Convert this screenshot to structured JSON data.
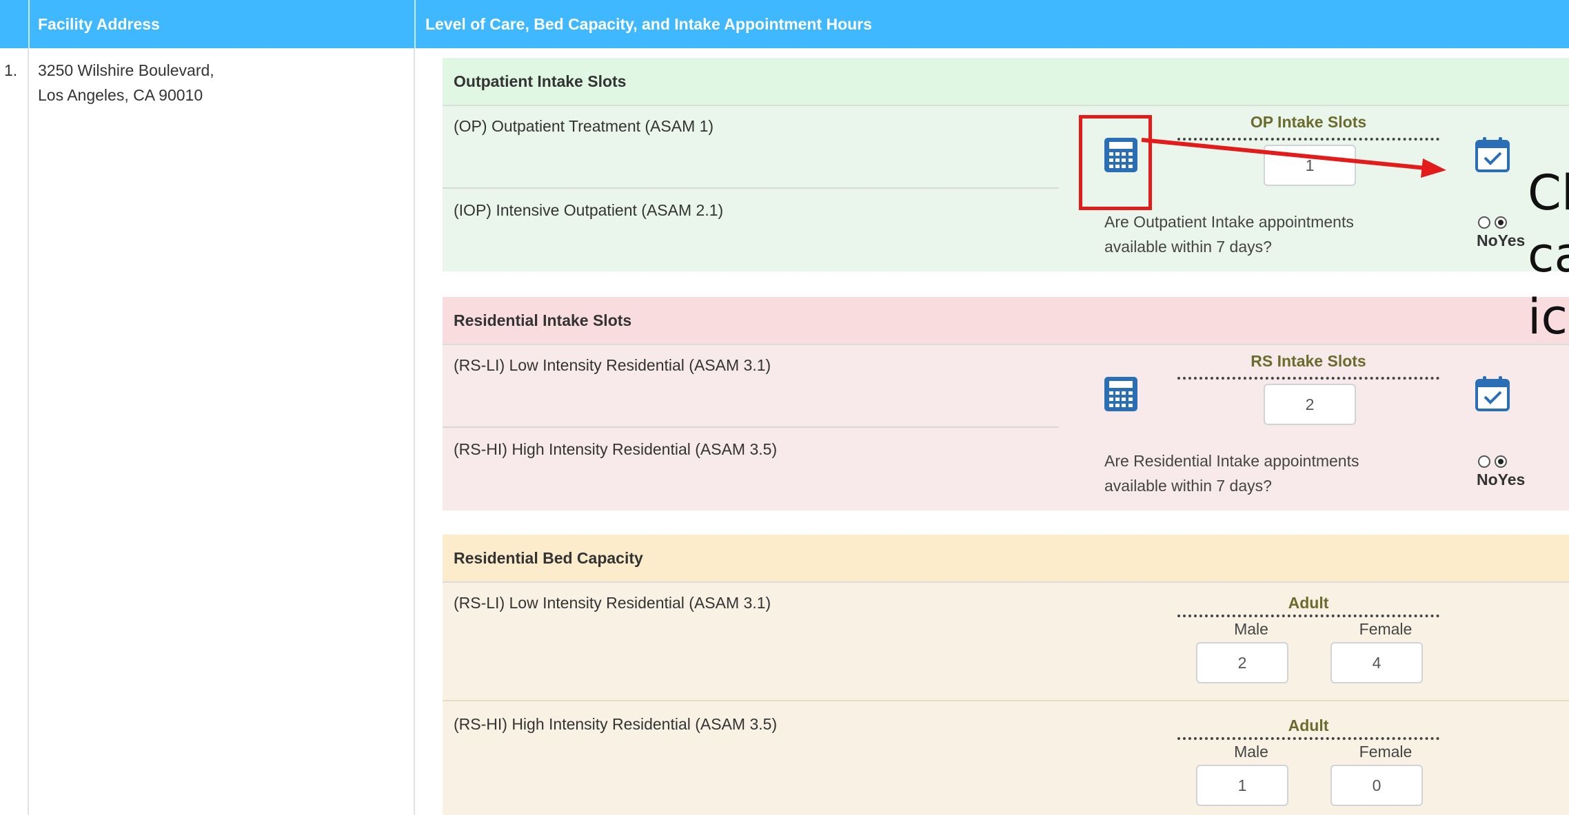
{
  "table": {
    "headers": {
      "address": "Facility Address",
      "care": "Level of Care, Bed Capacity, and Intake Appointment Hours"
    },
    "row": {
      "number": "1.",
      "address_line1": "3250 Wilshire Boulevard,",
      "address_line2": "Los Angeles, CA 90010"
    }
  },
  "outpatient": {
    "title": "Outpatient Intake Slots",
    "items": [
      "(OP) Outpatient Treatment (ASAM 1)",
      "(IOP) Intensive Outpatient (ASAM 2.1)"
    ],
    "slots_label": "OP Intake Slots",
    "slots_value": "1",
    "question_line1": "Are Outpatient Intake appointments",
    "question_line2": "available within 7 days?",
    "selected": "Yes",
    "noyes": "NoYes"
  },
  "residential": {
    "title": "Residential Intake Slots",
    "items": [
      "(RS-LI) Low Intensity Residential (ASAM 3.1)",
      "(RS-HI) High Intensity Residential (ASAM 3.5)"
    ],
    "slots_label": "RS Intake Slots",
    "slots_value": "2",
    "question_line1": "Are Residential Intake appointments",
    "question_line2": "available within 7 days?",
    "selected": "Yes",
    "noyes": "NoYes"
  },
  "bed_capacity": {
    "title": "Residential Bed Capacity",
    "rows": [
      {
        "label": "(RS-LI) Low Intensity Residential (ASAM 3.1)",
        "group": "Adult",
        "male_label": "Male",
        "female_label": "Female",
        "male": "2",
        "female": "4"
      },
      {
        "label": "(RS-HI) High Intensity Residential (ASAM 3.5)",
        "group": "Adult",
        "male_label": "Male",
        "female_label": "Female",
        "male": "1",
        "female": "0"
      }
    ]
  },
  "annotation": {
    "line1": "Cl",
    "line2": "ca",
    "line3": "ic"
  },
  "colors": {
    "header": "#3fb8ff",
    "outpatient": "#eaf6ec",
    "residential": "#f8eaea",
    "bed_capacity": "#f9f2e4",
    "annotation": "#e41b1b",
    "icon": "#2a6fb5"
  },
  "icons": {
    "slot_calculator": "calculator-icon",
    "schedule": "calendar-check-icon"
  }
}
